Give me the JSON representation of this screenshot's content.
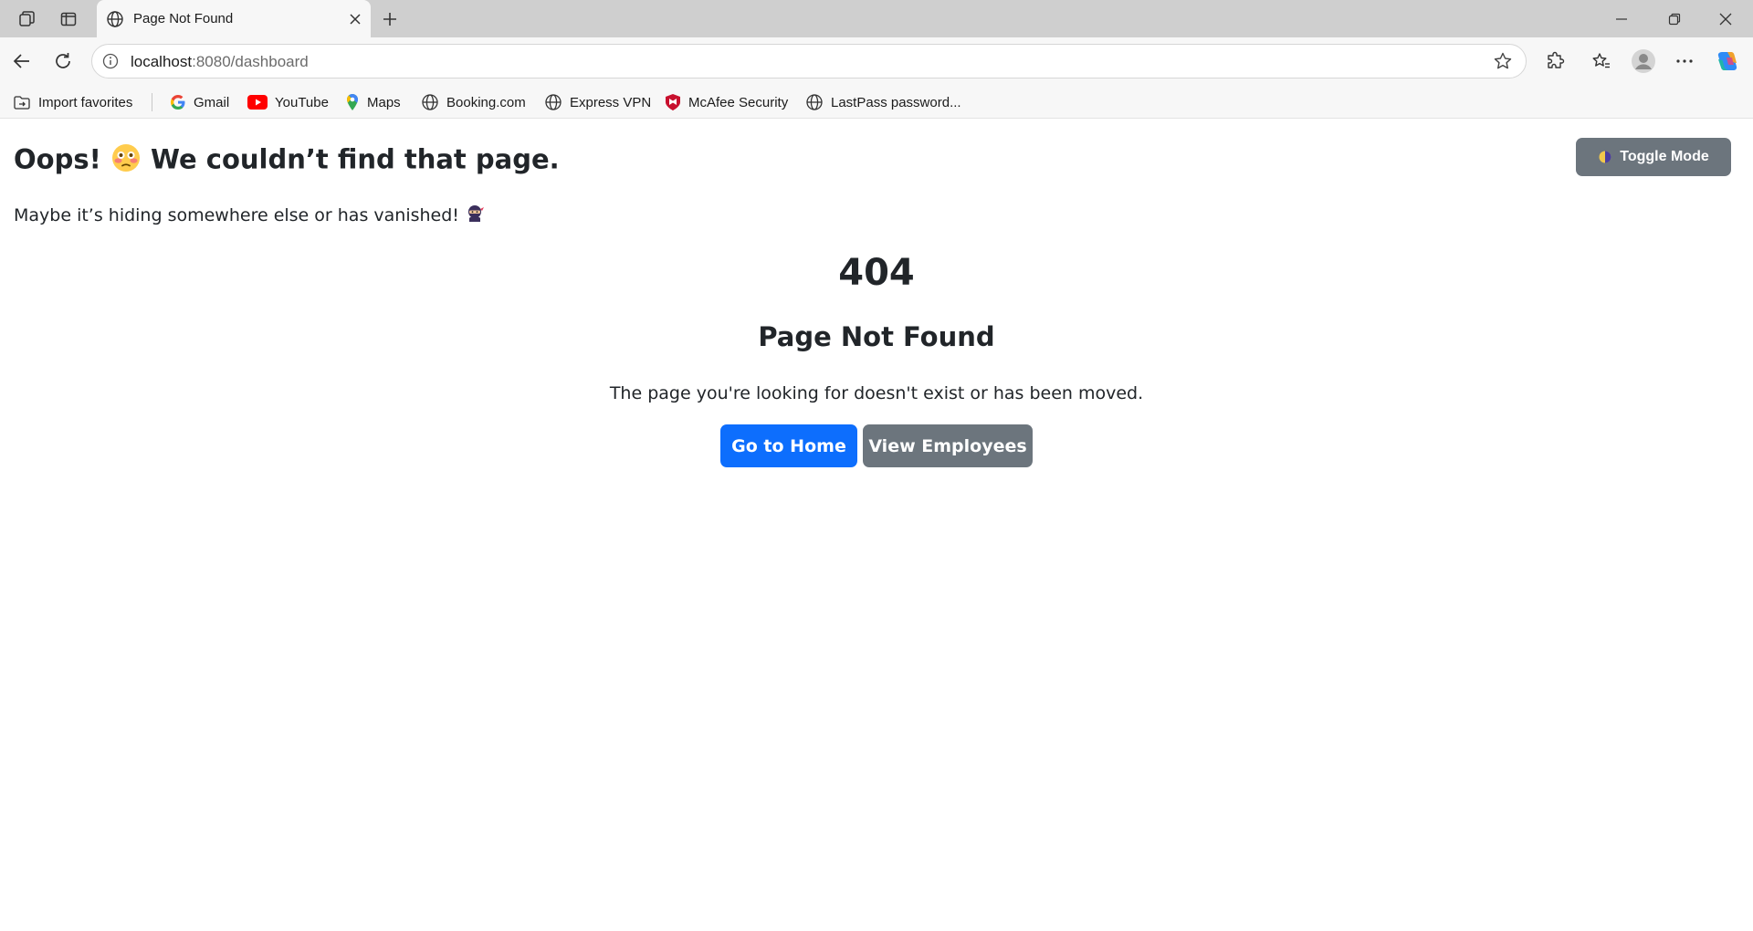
{
  "browser": {
    "tab": {
      "title": "Page Not Found"
    },
    "address": {
      "host": "localhost",
      "port_path": ":8080/dashboard"
    },
    "bookmarks": [
      {
        "label": "Import favorites",
        "icon": "import-favorites-icon"
      },
      {
        "label": "Gmail",
        "icon": "google-icon"
      },
      {
        "label": "YouTube",
        "icon": "youtube-icon"
      },
      {
        "label": "Maps",
        "icon": "maps-pin-icon"
      },
      {
        "label": "Booking.com",
        "icon": "globe-icon"
      },
      {
        "label": "Express VPN",
        "icon": "globe-icon"
      },
      {
        "label": "McAfee Security",
        "icon": "mcafee-icon"
      },
      {
        "label": "LastPass password...",
        "icon": "globe-icon"
      }
    ]
  },
  "page": {
    "heading_prefix": "Oops!",
    "heading_suffix": "We couldn’t find that page.",
    "heading_emoji": "flushed-face-emoji",
    "subtext": "Maybe it’s hiding somewhere else or has vanished!",
    "subtext_emoji": "ninja-emoji",
    "toggle_label": "Toggle Mode",
    "toggle_icon": "half-moon-icon",
    "code": "404",
    "title": "Page Not Found",
    "description": "The page you're looking for doesn't exist or has been moved.",
    "home_button": "Go to Home",
    "employees_button": "View Employees"
  },
  "colors": {
    "primary": "#0d6efd",
    "secondary": "#6c757d",
    "text": "#212529"
  }
}
